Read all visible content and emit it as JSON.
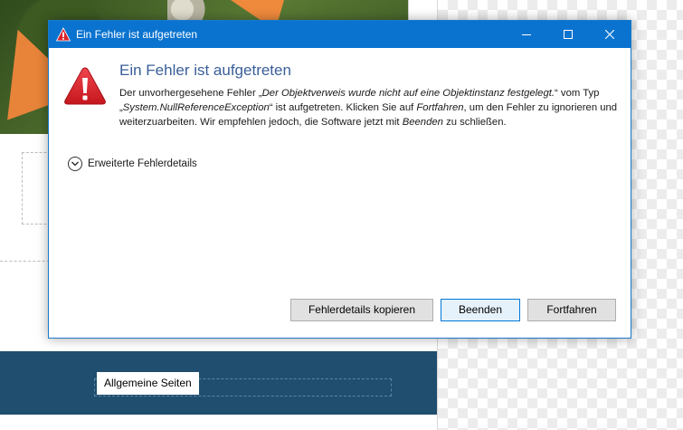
{
  "background": {
    "chip_label": "Allgemeine Seiten"
  },
  "dialog": {
    "window_title": "Ein Fehler ist aufgetreten",
    "heading": "Ein Fehler ist aufgetreten",
    "message": {
      "part1": "Der unvorhergesehene Fehler „",
      "error_message": "Der Objektverweis wurde nicht auf eine Objektinstanz festgelegt.",
      "part2": "“ vom Typ „",
      "exception_type": "System.NullReferenceException",
      "part3": "“ ist aufgetreten. Klicken Sie auf ",
      "continue_word": "Fortfahren",
      "part4": ", um den Fehler zu ignorieren und weiterzuarbeiten. Wir empfehlen jedoch, die Software jetzt mit ",
      "quit_word": "Beenden",
      "part5": " zu schließen."
    },
    "details_toggle_label": "Erweiterte Fehlerdetails",
    "buttons": {
      "copy_details": "Fehlerdetails kopieren",
      "quit": "Beenden",
      "continue": "Fortfahren"
    },
    "icons": {
      "title": "warning-icon",
      "main": "error-warning-icon",
      "minimize": "minimize-icon",
      "maximize": "maximize-icon",
      "close": "close-icon",
      "expand": "chevron-down-icon"
    },
    "colors": {
      "titlebar": "#0a73cf",
      "heading": "#3a5f99",
      "warning_red": "#d9232b",
      "default_button_border": "#0078d7"
    }
  }
}
